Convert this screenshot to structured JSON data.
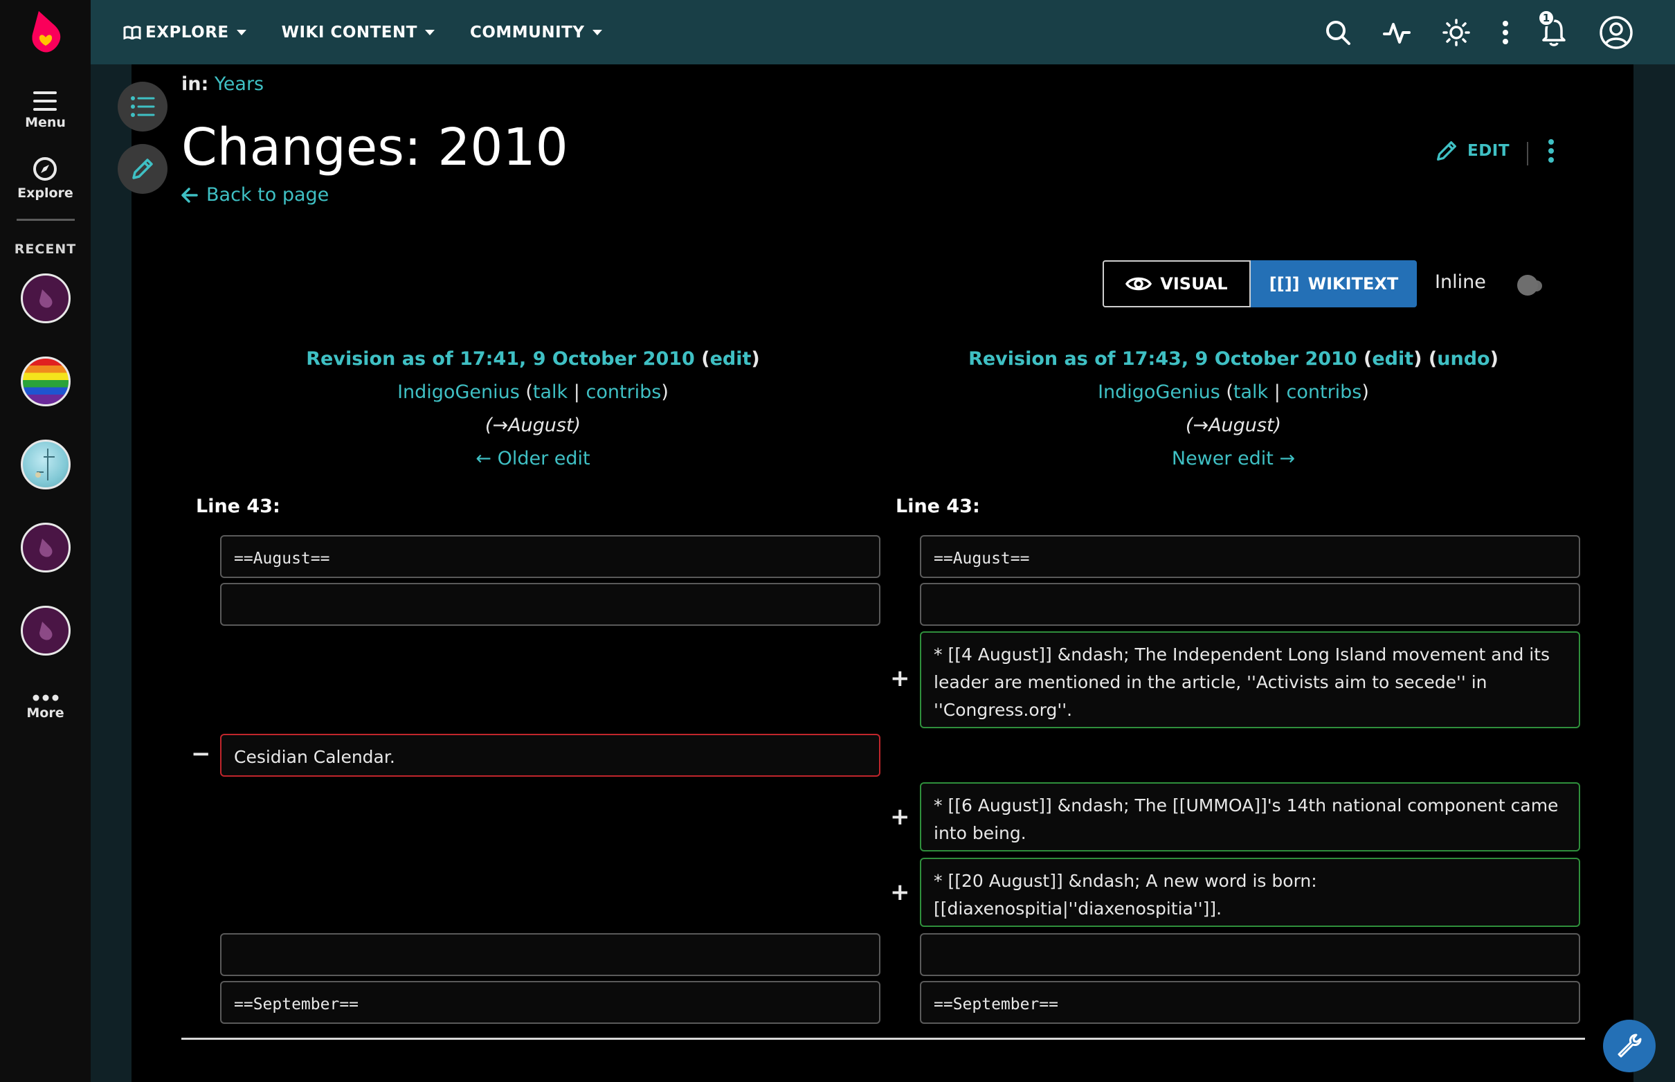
{
  "rail": {
    "menu_label": "Menu",
    "explore_label": "Explore",
    "recent_label": "RECENT",
    "more_label": "More"
  },
  "topbar": {
    "nav": [
      {
        "label": "EXPLORE"
      },
      {
        "label": "WIKI CONTENT"
      },
      {
        "label": "COMMUNITY"
      }
    ],
    "notification_count": "1"
  },
  "header": {
    "in_label": "in:",
    "category": "Years",
    "title": "Changes: 2010",
    "back_link": "Back to page",
    "edit_label": "EDIT"
  },
  "view_modes": {
    "visual": "VISUAL",
    "wikitext_icon": "[[]]",
    "wikitext": "WIKITEXT",
    "inline": "Inline"
  },
  "old_revision": {
    "title": "Revision as of 17:41, 9 October 2010",
    "edit": "edit",
    "user": "IndigoGenius",
    "talk": "talk",
    "contribs": "contribs",
    "summary": "(→August)",
    "nav": "← Older edit"
  },
  "new_revision": {
    "title": "Revision as of 17:43, 9 October 2010",
    "edit": "edit",
    "undo": "undo",
    "user": "IndigoGenius",
    "talk": "talk",
    "contribs": "contribs",
    "summary": "(→August)",
    "nav": "Newer edit →"
  },
  "diff": {
    "left_line": "Line 43:",
    "right_line": "Line 43:",
    "left_rows": {
      "august": "==August==",
      "blank1": "",
      "removed": "Cesidian Calendar.",
      "blank2": "",
      "september": "==September=="
    },
    "right_rows": {
      "august": "==August==",
      "blank1": "",
      "added1": "* [[4 August]] &ndash; The Independent Long Island movement and its leader are mentioned in the article, ''Activists aim to secede'' in ''Congress.org''.",
      "added2": "* [[6 August]] &ndash; The [[UMMOA]]'s 14th national component came into being.",
      "added3": "* [[20 August]] &ndash; A new word is born: [[diaxenospitia|''diaxenospitia'']].",
      "blank2": "",
      "september": "==September=="
    },
    "minus": "−",
    "plus": "+"
  },
  "colors": {
    "accent": "#3fc0c4",
    "topbar": "#193f47",
    "primary_button": "#2470b6",
    "deleted_border": "#c0262c",
    "added_border": "#2f8f3c"
  },
  "icons": [
    "fandom-logo-icon",
    "menu-icon",
    "compass-icon",
    "wiki-avatar-icon",
    "more-dots-icon",
    "search-icon",
    "activity-icon",
    "theme-icon",
    "kebab-icon",
    "bell-icon",
    "user-icon",
    "toc-icon",
    "pencil-icon",
    "arrow-left-icon",
    "eye-icon",
    "wrench-icon"
  ]
}
